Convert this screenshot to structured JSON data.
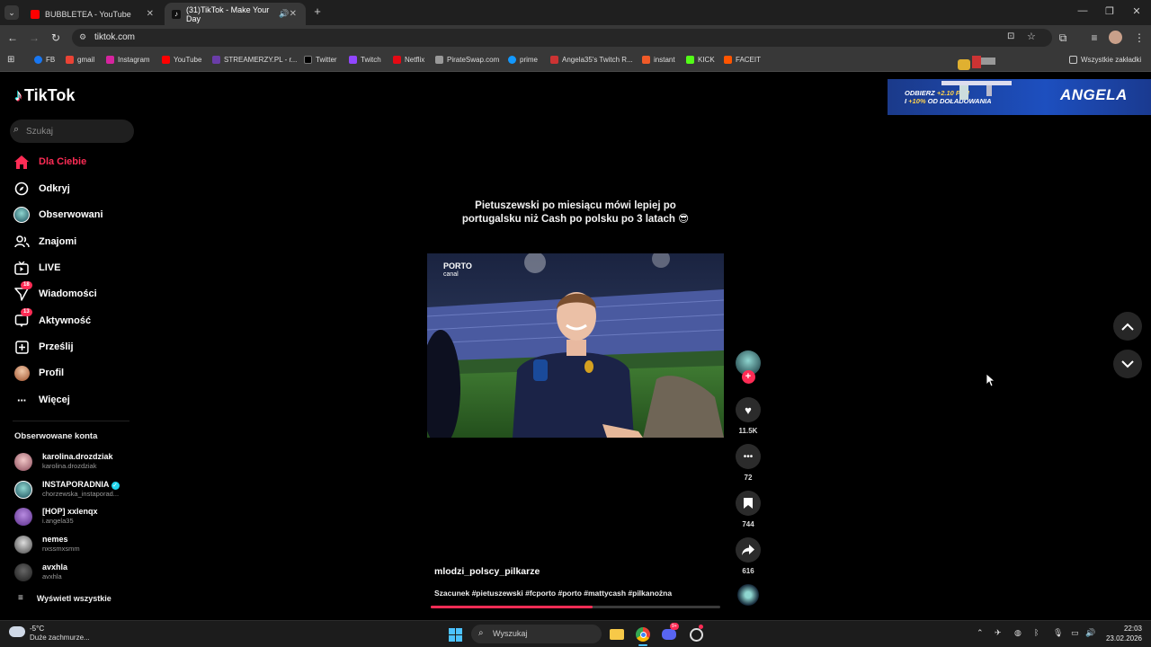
{
  "browser": {
    "tabs": [
      {
        "title": "BUBBLETEA - YouTube",
        "favicon": "youtube-icon"
      },
      {
        "title": "(31)TikTok - Make Your Day",
        "favicon": "tiktok-icon",
        "active": true
      }
    ],
    "url": "tiktok.com",
    "bookmarks": [
      "FB",
      "gmail",
      "Instagram",
      "YouTube",
      "STREAMERZY.PL - r...",
      "Twitter",
      "Twitch",
      "Netflix",
      "PirateSwap.com",
      "prime",
      "Angela35's Twitch R...",
      "instant",
      "KICK",
      "FACEIT"
    ],
    "all_bookmarks": "Wszystkie zakładki"
  },
  "tiktok": {
    "logo": "TikTok",
    "search_placeholder": "Szukaj",
    "nav": [
      {
        "label": "Dla Ciebie",
        "active": true,
        "icon": "home-icon"
      },
      {
        "label": "Odkryj",
        "icon": "compass-icon"
      },
      {
        "label": "Obserwowani",
        "icon": "following-avatar-icon"
      },
      {
        "label": "Znajomi",
        "icon": "friends-icon"
      },
      {
        "label": "LIVE",
        "icon": "live-icon"
      },
      {
        "label": "Wiadomości",
        "icon": "messages-icon",
        "badge": "18"
      },
      {
        "label": "Aktywność",
        "icon": "activity-icon",
        "badge": "13"
      },
      {
        "label": "Prześlij",
        "icon": "upload-icon"
      },
      {
        "label": "Profil",
        "icon": "profile-icon"
      },
      {
        "label": "Więcej",
        "icon": "more-icon"
      }
    ],
    "followed_title": "Obserwowane konta",
    "followed": [
      {
        "name": "karolina.drozdziak",
        "handle": "karolina.drozdziak"
      },
      {
        "name": "INSTAPORADNIA",
        "handle": "chorzewska_instaporad...",
        "verified": true
      },
      {
        "name": "[HOP] xxlenqx",
        "handle": "i.angela35"
      },
      {
        "name": "nemes",
        "handle": "nxssmxsmm"
      },
      {
        "name": "avxhla",
        "handle": "avxhla"
      }
    ],
    "show_all": "Wyświetl wszystkie"
  },
  "video": {
    "overlay_caption_line1": "Pietuszewski po miesiącu mówi lepiej po",
    "overlay_caption_line2": "portugalsku niż Cash po polsku po 3 latach 😎",
    "channel_logo": "PORTO",
    "channel_logo_sub": "canal",
    "author": "mlodzi_polscy_pilkarze",
    "description": "Szacunek #pietuszewski #fcporto #porto #mattycash #pilkanożna",
    "likes": "11.5K",
    "comments": "72",
    "saves": "744",
    "shares": "616",
    "progress": 0.56
  },
  "ad": {
    "line1_prefix": "ODBIERZ ",
    "line1_amount": "+2.10 PLN",
    "line2_prefix": "I ",
    "line2_amount": "+10%",
    "line2_suffix": " OD DOŁADOWANIA",
    "brand": "ANGELA"
  },
  "taskbar": {
    "temperature": "-5°C",
    "weather": "Duże zachmurze...",
    "search": "Wyszukaj",
    "time": "22:03",
    "date": "23.02.2026",
    "discord_badge": "9+"
  },
  "colors": {
    "accent": "#fe2c55",
    "tiktok_cyan": "#25f4ee",
    "background": "#000000"
  }
}
